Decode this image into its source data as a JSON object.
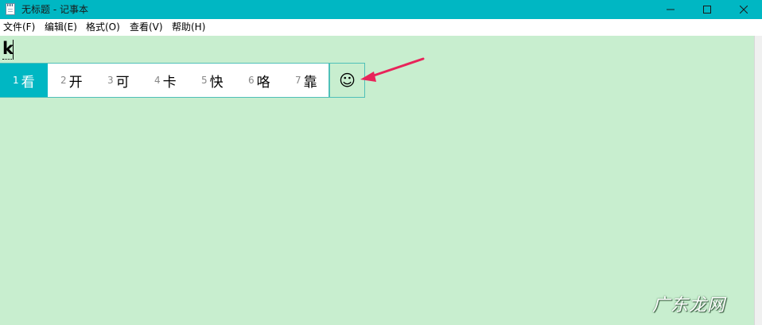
{
  "window": {
    "title": "无标题 - 记事本",
    "controls": [
      "minimize",
      "maximize",
      "close"
    ]
  },
  "menubar": {
    "items": [
      "文件(F)",
      "编辑(E)",
      "格式(O)",
      "查看(V)",
      "帮助(H)"
    ]
  },
  "editor": {
    "composition_text": "k"
  },
  "ime": {
    "candidates": [
      {
        "num": "1",
        "char": "看"
      },
      {
        "num": "2",
        "char": "开"
      },
      {
        "num": "3",
        "char": "可"
      },
      {
        "num": "4",
        "char": "卡"
      },
      {
        "num": "5",
        "char": "快"
      },
      {
        "num": "6",
        "char": "咯"
      },
      {
        "num": "7",
        "char": "靠"
      }
    ],
    "selected_index": 0,
    "emoji_button": "☺"
  },
  "watermark": {
    "text": "广东龙网"
  },
  "colors": {
    "titlebar": "#00b7c3",
    "editor_bg": "#c8eecf",
    "accent": "#00b7c3",
    "arrow": "#e8245a"
  }
}
